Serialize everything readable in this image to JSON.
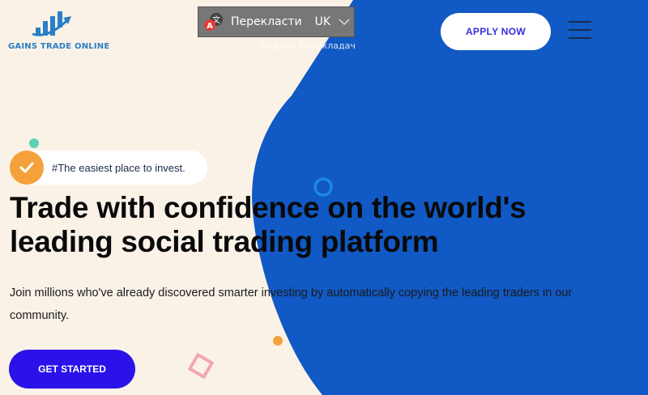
{
  "brand": {
    "name": "GAINS TRADE ONLINE",
    "logo_icon": "chart-bars-arrow-icon",
    "color": "#2a7fc5"
  },
  "translate_widget": {
    "label": "Перекласти",
    "language": "UK",
    "provider_note": "Надано Перекладач"
  },
  "header": {
    "apply_label": "APPLY NOW",
    "menu_icon": "hamburger-menu-icon"
  },
  "hero": {
    "tagline": "#The easiest place to invest.",
    "title": "Trade with confidence on the world's leading social trading platform",
    "subtitle": "Join millions who've already discovered smarter investing by automatically copying the leading traders in our community.",
    "cta_label": "GET STARTED"
  },
  "colors": {
    "background": "#fbf2e7",
    "blue_shape": "#1159c4",
    "accent_purple": "#2b12e8",
    "orange": "#f5a13b",
    "teal": "#5fd0b5",
    "pink": "#f2a7b0"
  }
}
